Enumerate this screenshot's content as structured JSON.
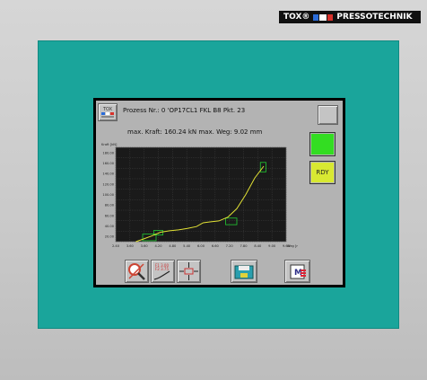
{
  "brand": {
    "name": "PRESSOTECHNIK",
    "logo_text": "TOX®"
  },
  "header": {
    "process_text": "Prozess Nr.: 0  'OP17CL1 FKL B8 Pkt. 23",
    "max_text": "max. Kraft: 160.24 kN  max. Weg: 9.02 mm"
  },
  "status": {
    "ready_label": "RDY",
    "ok_color": "#33dd22",
    "ready_color": "#d8e832"
  },
  "chart_data": {
    "type": "line",
    "title": "",
    "ylabel": "Kraft [kN]",
    "xlabel": "Weg [mm]",
    "xlim": [
      2.4,
      10.0
    ],
    "ylim": [
      0,
      200
    ],
    "yticks": [
      "180.00",
      "160.00",
      "140.00",
      "120.00",
      "100.00",
      "80.00",
      "60.00",
      "40.00",
      "20.00"
    ],
    "xticks": [
      "2.40",
      "3.60",
      "3.60",
      "4.20",
      "4.80",
      "5.40",
      "6.00",
      "6.60",
      "7.20",
      "7.80",
      "8.40",
      "9.00",
      "9.60"
    ],
    "grid": true,
    "series": [
      {
        "color": "#e2e235",
        "x": [
          3.3,
          3.6,
          4.0,
          4.4,
          4.8,
          5.2,
          5.6,
          6.0,
          6.3,
          6.6,
          7.0,
          7.4,
          7.8,
          8.2,
          8.6,
          9.0
        ],
        "y": [
          0,
          5,
          12,
          20,
          23,
          25,
          28,
          32,
          40,
          42,
          44,
          52,
          70,
          100,
          135,
          160
        ]
      }
    ],
    "windows": [
      {
        "x1": 3.6,
        "x2": 4.2,
        "y1": 2,
        "y2": 16
      },
      {
        "x1": 4.1,
        "x2": 4.5,
        "y1": 14,
        "y2": 24
      },
      {
        "x1": 7.3,
        "x2": 7.8,
        "y1": 36,
        "y2": 50
      },
      {
        "x1": 8.85,
        "x2": 9.1,
        "y1": 148,
        "y2": 168
      }
    ]
  },
  "icons": {
    "logo": "tox-logo-icon",
    "top_right": "blank-button",
    "b1": "magnifier-icon",
    "b2": "curve-list-icon",
    "b3": "axis-adjust-icon",
    "b4": "save-disk-icon",
    "b5": "menu-icon"
  },
  "bottom_button_texts": {
    "b5": "M"
  }
}
